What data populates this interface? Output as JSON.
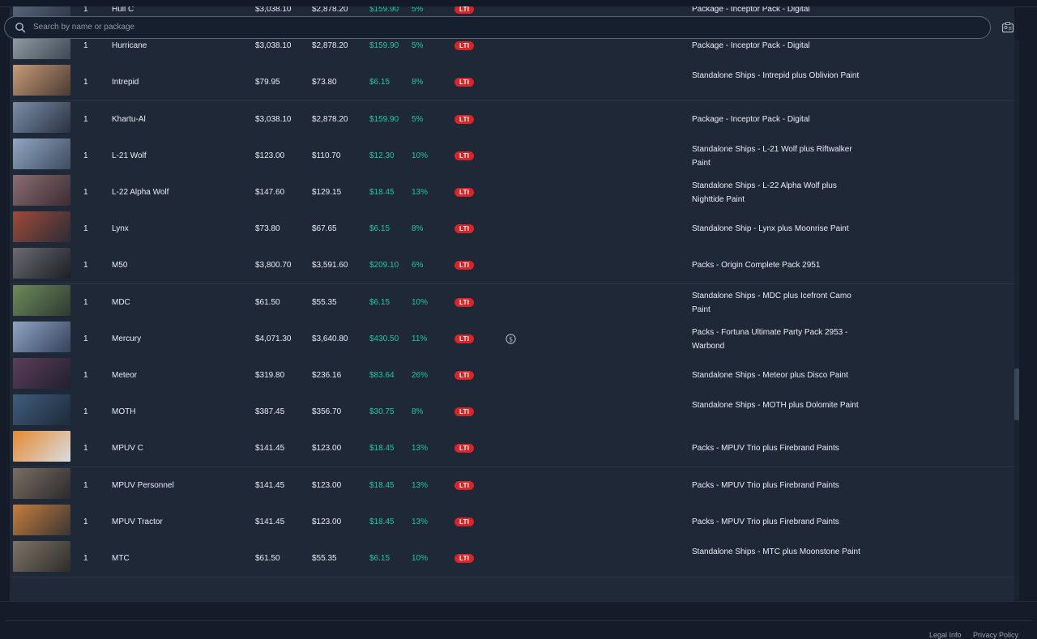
{
  "search": {
    "placeholder": "Search by name or package"
  },
  "colors": {
    "accent_green": "#22c7a0",
    "lti_red": "#d7262a",
    "background": "#1e2837"
  },
  "rows": [
    {
      "qty": "1",
      "name": "Hull C",
      "msrp": "$3,038.10",
      "paid": "$2,878.20",
      "save": "$159.90",
      "pct": "5%",
      "badge": "LTI",
      "pkg": "Package - Inceptor Pack - Digital",
      "coin": false
    },
    {
      "qty": "1",
      "name": "Hurricane",
      "msrp": "$3,038.10",
      "paid": "$2,878.20",
      "save": "$159.90",
      "pct": "5%",
      "badge": "LTI",
      "pkg": "Package - Inceptor Pack - Digital",
      "coin": false
    },
    {
      "qty": "1",
      "name": "Intrepid",
      "msrp": "$79.95",
      "paid": "$73.80",
      "save": "$6.15",
      "pct": "8%",
      "badge": "LTI",
      "pkg": "Standalone Ships - Intrepid plus Oblivion Paint",
      "coin": false
    },
    {
      "qty": "1",
      "name": "Khartu-Al",
      "msrp": "$3,038.10",
      "paid": "$2,878.20",
      "save": "$159.90",
      "pct": "5%",
      "badge": "LTI",
      "pkg": "Package - Inceptor Pack - Digital",
      "coin": false
    },
    {
      "qty": "1",
      "name": "L-21 Wolf",
      "msrp": "$123.00",
      "paid": "$110.70",
      "save": "$12.30",
      "pct": "10%",
      "badge": "LTI",
      "pkg": "Standalone Ships - L-21 Wolf plus Riftwalker Paint",
      "coin": false
    },
    {
      "qty": "1",
      "name": "L-22 Alpha Wolf",
      "msrp": "$147.60",
      "paid": "$129.15",
      "save": "$18.45",
      "pct": "13%",
      "badge": "LTI",
      "pkg": "Standalone Ships - L-22 Alpha Wolf plus Nighttide Paint",
      "coin": false
    },
    {
      "qty": "1",
      "name": "Lynx",
      "msrp": "$73.80",
      "paid": "$67.65",
      "save": "$6.15",
      "pct": "8%",
      "badge": "LTI",
      "pkg": "Standalone Ship - Lynx plus Moonrise Paint",
      "coin": false
    },
    {
      "qty": "1",
      "name": "M50",
      "msrp": "$3,800.70",
      "paid": "$3,591.60",
      "save": "$209.10",
      "pct": "6%",
      "badge": "LTI",
      "pkg": "Packs - Origin Complete Pack 2951",
      "coin": false
    },
    {
      "qty": "1",
      "name": "MDC",
      "msrp": "$61.50",
      "paid": "$55.35",
      "save": "$6.15",
      "pct": "10%",
      "badge": "LTI",
      "pkg": "Standalone Ships - MDC plus Icefront Camo Paint",
      "coin": false
    },
    {
      "qty": "1",
      "name": "Mercury",
      "msrp": "$4,071.30",
      "paid": "$3,640.80",
      "save": "$430.50",
      "pct": "11%",
      "badge": "LTI",
      "pkg": "Packs - Fortuna Ultimate Party Pack 2953 - Warbond",
      "coin": true
    },
    {
      "qty": "1",
      "name": "Meteor",
      "msrp": "$319.80",
      "paid": "$236.16",
      "save": "$83.64",
      "pct": "26%",
      "badge": "LTI",
      "pkg": "Standalone Ships - Meteor plus Disco Paint",
      "coin": false
    },
    {
      "qty": "1",
      "name": "MOTH",
      "msrp": "$387.45",
      "paid": "$356.70",
      "save": "$30.75",
      "pct": "8%",
      "badge": "LTI",
      "pkg": "Standalone Ships - MOTH plus Dolomite Paint",
      "coin": false
    },
    {
      "qty": "1",
      "name": "MPUV C",
      "msrp": "$141.45",
      "paid": "$123.00",
      "save": "$18.45",
      "pct": "13%",
      "badge": "LTI",
      "pkg": "Packs - MPUV Trio plus Firebrand Paints",
      "coin": false
    },
    {
      "qty": "1",
      "name": "MPUV Personnel",
      "msrp": "$141.45",
      "paid": "$123.00",
      "save": "$18.45",
      "pct": "13%",
      "badge": "LTI",
      "pkg": "Packs - MPUV Trio plus Firebrand Paints",
      "coin": false
    },
    {
      "qty": "1",
      "name": "MPUV Tractor",
      "msrp": "$141.45",
      "paid": "$123.00",
      "save": "$18.45",
      "pct": "13%",
      "badge": "LTI",
      "pkg": "Packs - MPUV Trio plus Firebrand Paints",
      "coin": false
    },
    {
      "qty": "1",
      "name": "MTC",
      "msrp": "$61.50",
      "paid": "$55.35",
      "save": "$6.15",
      "pct": "10%",
      "badge": "LTI",
      "pkg": "Standalone Ships - MTC plus Moonstone Paint",
      "coin": false
    }
  ],
  "footer": {
    "legal": "Legal Info",
    "privacy": "Privacy Policy"
  }
}
